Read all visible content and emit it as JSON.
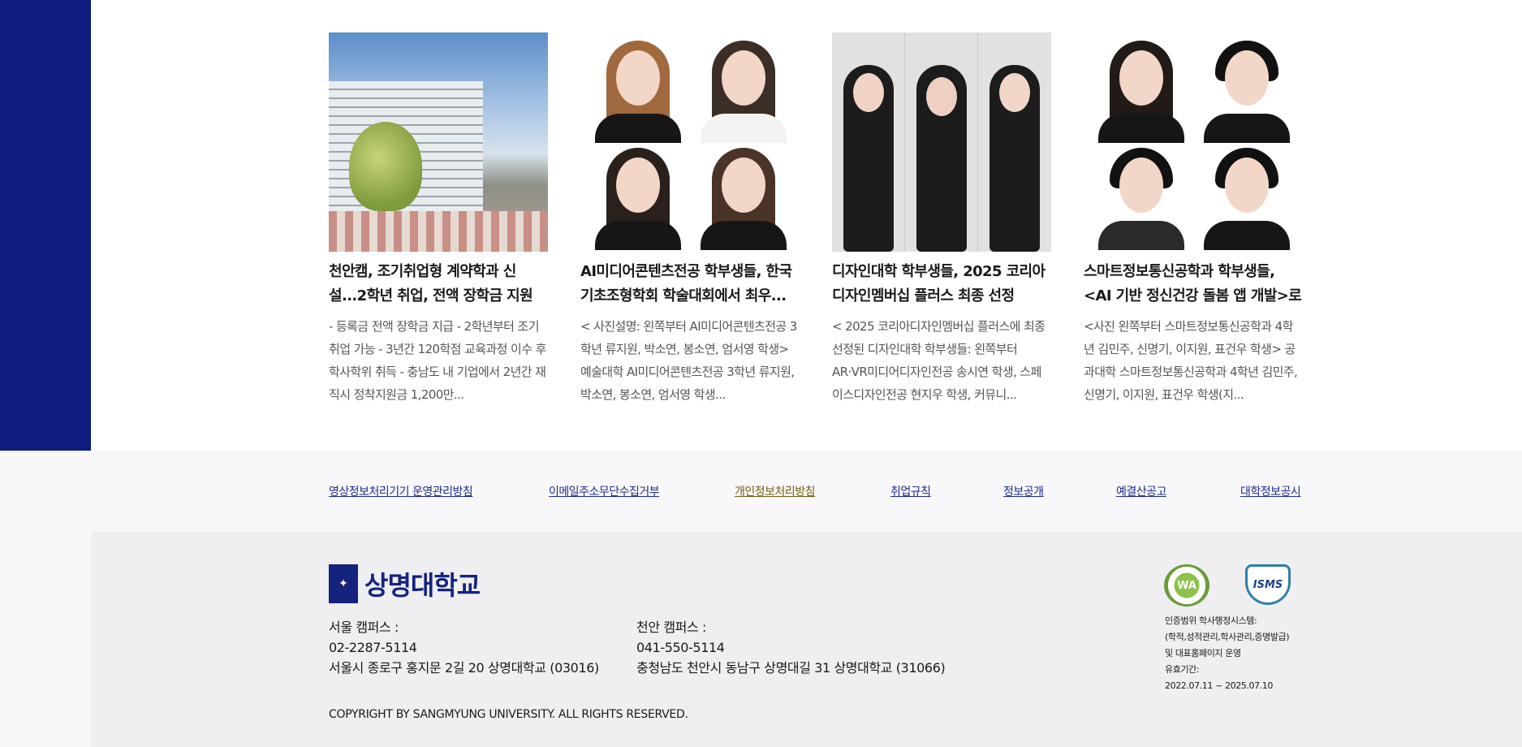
{
  "news": [
    {
      "title": "천안캠, 조기취업형 계약학과 신설...2학년 취업, 전액 장학금 지원",
      "desc": "- 등록금 전액 장학금 지급 - 2학년부터 조기 취업 가능 - 3년간 120학점 교육과정 이수 후 학사학위 취득 - 충남도 내 기업에서 2년간 재직시 정착지원금 1,200만..."
    },
    {
      "title": "AI미디어콘텐츠전공 학부생들, 한국기초조형학회 학술대회에서 최우...",
      "desc": "< 사진설명: 왼쪽부터 AI미디어콘텐츠전공 3학년 류지원, 박소연, 봉소연, 엄서영 학생> 예술대학 AI미디어콘텐츠전공 3학년 류지원, 박소연, 봉소연, 엄서영 학생..."
    },
    {
      "title": "디자인대학 학부생들, 2025 코리아디자인멤버십 플러스 최종 선정",
      "desc": "< 2025 코리아디자인멤버십 플러스에 최종 선정된 디자인대학 학부생들: 왼쪽부터 AR·VR미디어디자인전공 송시연 학생, 스페이스디자인전공 현지우 학생, 커뮤니..."
    },
    {
      "title": "스마트정보통신공학과 학부생들, <AI 기반 정신건강 돌봄 앱 개발>로 우...",
      "desc": "<사진 왼쪽부터 스마트정보통신공학과 4학년 김민주, 신명기, 이지원, 표건우 학생> 공과대학 스마트정보통신공학과 4학년 김민주, 신명기, 이지원, 표건우 학생(지..."
    }
  ],
  "links": [
    "영상정보처리기기 운영관리방침",
    "이메일주소무단수집거부",
    "개인정보처리방침",
    "취업규칙",
    "정보공개",
    "예결산공고",
    "대학정보공시"
  ],
  "footer": {
    "logo_text": "상명대학교",
    "seoul": {
      "label": "서울 캠퍼스 :",
      "phone": "02-2287-5114",
      "address": "서울시 종로구 홍지문 2길 20 상명대학교 (03016)"
    },
    "cheonan": {
      "label": "천안 캠퍼스 :",
      "phone": "041-550-5114",
      "address": "충청남도 천안시 동남구 상명대길 31 상명대학교 (31066)"
    },
    "copyright": "COPYRIGHT BY SANGMYUNG UNIVERSITY. ALL RIGHTS RESERVED.",
    "cert": [
      "인증범위 학사행정시스템:",
      "(학적,성적관리,학사관리,증명발급)",
      "및 대표홈페이지 운영",
      "유효기간:",
      "2022.07.11 ~ 2025.07.10"
    ]
  },
  "colors": {
    "brand_navy": "#0f1c7f",
    "link_blue": "#1f2e8a",
    "active_link": "#7a5e12"
  }
}
